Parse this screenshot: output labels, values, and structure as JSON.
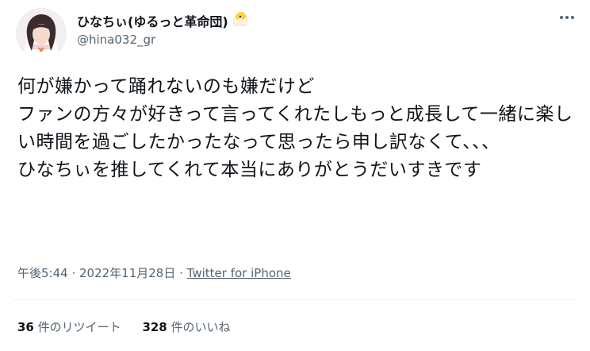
{
  "tweet": {
    "author": {
      "display_name": "ひなちぃ(ゆるっと革命団)",
      "name_emoji": "hatching-chick-icon",
      "handle": "@hina032_gr"
    },
    "text": "何が嫌かって踊れないのも嫌だけど\nファンの方々が好きって言ってくれたしもっと成長して一緒に楽しい時間を過ごしたかったなって思ったら申し訳なくて、、、\nひなちぃを推してくれて本当にありがとうだいすきです",
    "time": "午後5:44",
    "separator1": " · ",
    "date": "2022年11月28日",
    "separator2": " · ",
    "source": "Twitter for iPhone",
    "stats": {
      "retweets_count": "36",
      "retweets_label": " 件のリツイート",
      "likes_count": "328",
      "likes_label": " 件のいいね"
    }
  },
  "colors": {
    "text_primary": "#0f1419",
    "text_secondary": "#536471",
    "divider": "#eff3f4"
  }
}
